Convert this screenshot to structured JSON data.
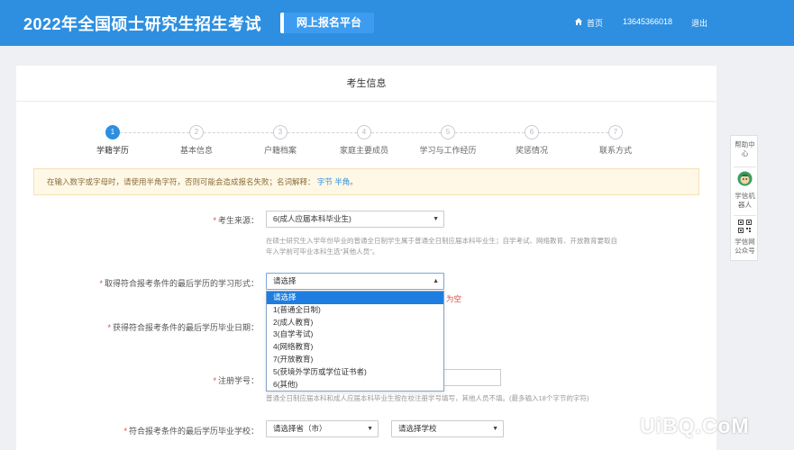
{
  "header": {
    "title": "2022年全国硕士研究生招生考试",
    "platform": "网上报名平台",
    "home": "首页",
    "phone": "13645366018",
    "logout": "退出"
  },
  "card": {
    "title": "考生信息"
  },
  "steps": [
    {
      "num": "1",
      "label": "学籍学历",
      "active": true
    },
    {
      "num": "2",
      "label": "基本信息",
      "active": false
    },
    {
      "num": "3",
      "label": "户籍档案",
      "active": false
    },
    {
      "num": "4",
      "label": "家庭主要成员",
      "active": false
    },
    {
      "num": "5",
      "label": "学习与工作经历",
      "active": false
    },
    {
      "num": "6",
      "label": "奖惩情况",
      "active": false
    },
    {
      "num": "7",
      "label": "联系方式",
      "active": false
    }
  ],
  "notice": {
    "text": "在输入数字或字母时，请使用半角字符，否则可能会造成报名失败；名词解释：",
    "link1": "字节",
    "link2": "半角",
    "end": "。"
  },
  "form": {
    "source_label": "考生来源：",
    "source_value": "6(成人应届本科毕业生)",
    "source_help1": "在硕士研究生入学年份毕业的普通全日制学生属于普通全日制应届本科毕业生；自学考试、网络教育、开放教育要取自",
    "source_help2": "年入学前可毕业本科生选\"其他人员\"。",
    "study_form_label": "取得符合报考条件的最后学历的学习形式：",
    "study_form_value": "请选择",
    "study_form_error": "为空",
    "grad_date_label": "获得符合报考条件的最后学历毕业日期：",
    "reg_no_label": "注册学号：",
    "reg_no_help": "普通全日制应届本科和成人应届本科毕业生按在校注册学号填写，其他人员不填。(最多输入18个字节的字符)",
    "school_label": "符合报考条件的最后学历毕业学校：",
    "province_value": "请选择省（市）",
    "school_value": "请选择学校"
  },
  "dropdown_options": [
    "请选择",
    "1(普通全日制)",
    "2(成人教育)",
    "3(自学考试)",
    "4(网络教育)",
    "7(开放教育)",
    "5(获境外学历或学位证书者)",
    "6(其他)"
  ],
  "sidebar": {
    "help": "帮助中心",
    "robot": "学信机器人",
    "wechat": "学信网公众号"
  },
  "watermark": "UiBQ.CoM"
}
